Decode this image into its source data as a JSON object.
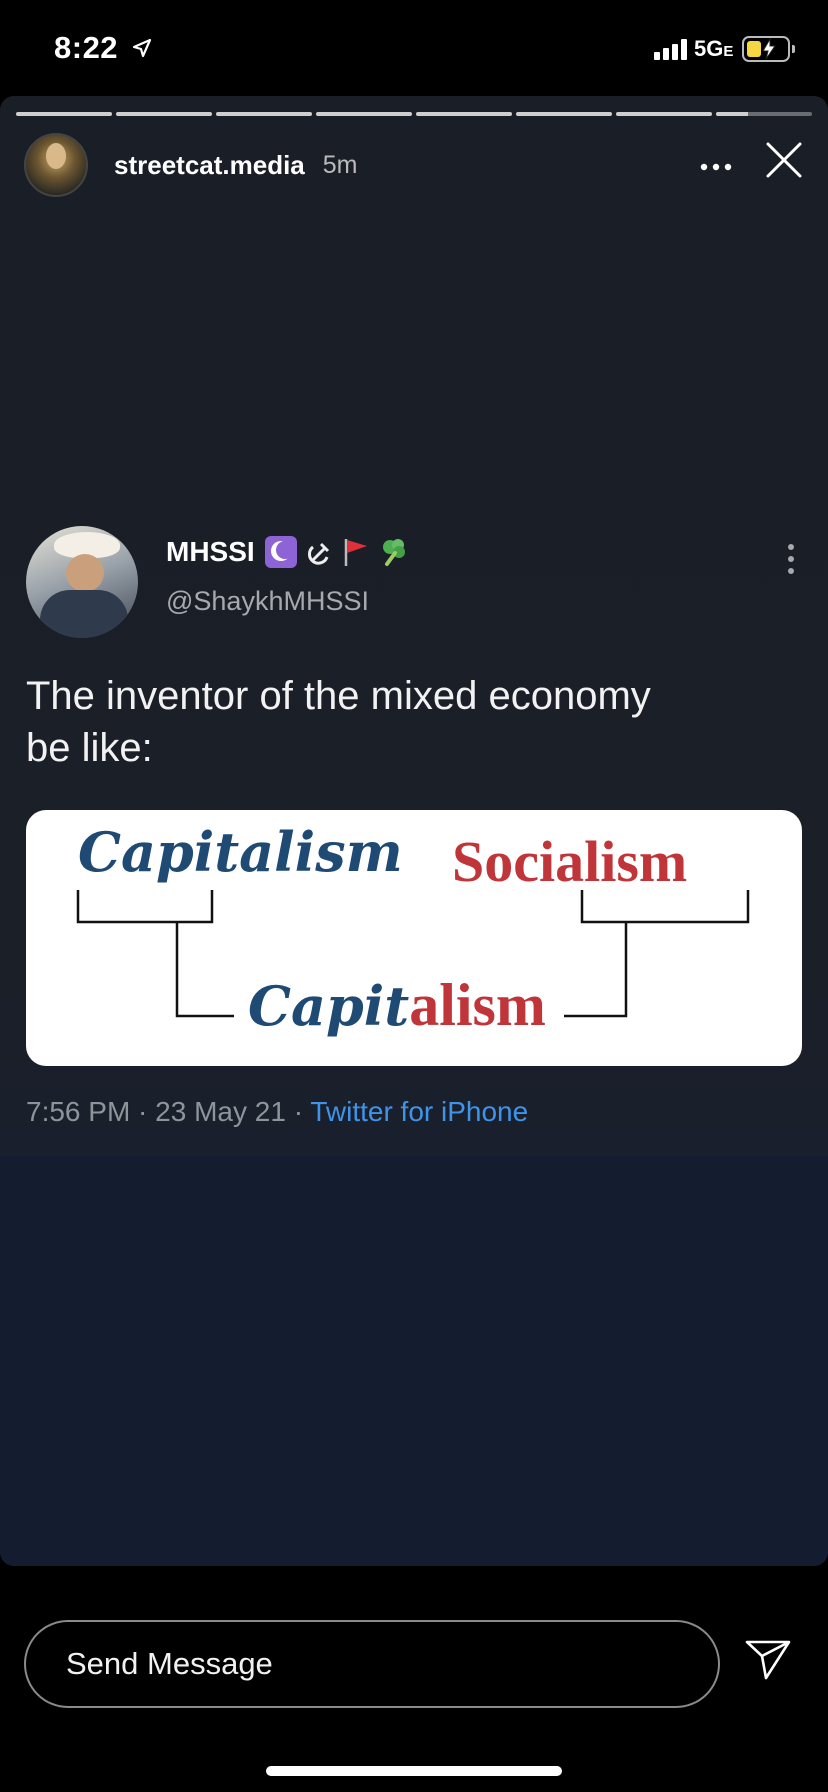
{
  "status_bar": {
    "time": "8:22",
    "network": "5G",
    "network_suffix": "E",
    "icons": [
      "location-arrow-icon",
      "signal-icon",
      "battery-charging-icon"
    ]
  },
  "story": {
    "username": "streetcat.media",
    "time_ago": "5m",
    "progress_segments": 8,
    "current_segment_progress": 0.33
  },
  "tweet": {
    "display_name": "MHSSI",
    "name_emojis": [
      "crescent-star-icon",
      "hammer-sickle-icon",
      "red-flag-icon",
      "broccoli-icon"
    ],
    "handle": "@ShaykhMHSSI",
    "text_line1": "The inventor of the mixed economy",
    "text_line2": "be like:",
    "meme": {
      "word_left": "Capitalism",
      "word_right": "Socialism",
      "combined_blue": "Capit",
      "combined_red": "alism"
    },
    "meta_time": "7:56 PM",
    "meta_sep1": " · ",
    "meta_date": "23 May 21",
    "meta_sep2": " · ",
    "meta_source": "Twitter for iPhone"
  },
  "reply": {
    "placeholder": "Send Message"
  },
  "colors": {
    "meme_blue": "#1f4a74",
    "meme_red": "#c0353a",
    "link_blue": "#3f93e8"
  }
}
